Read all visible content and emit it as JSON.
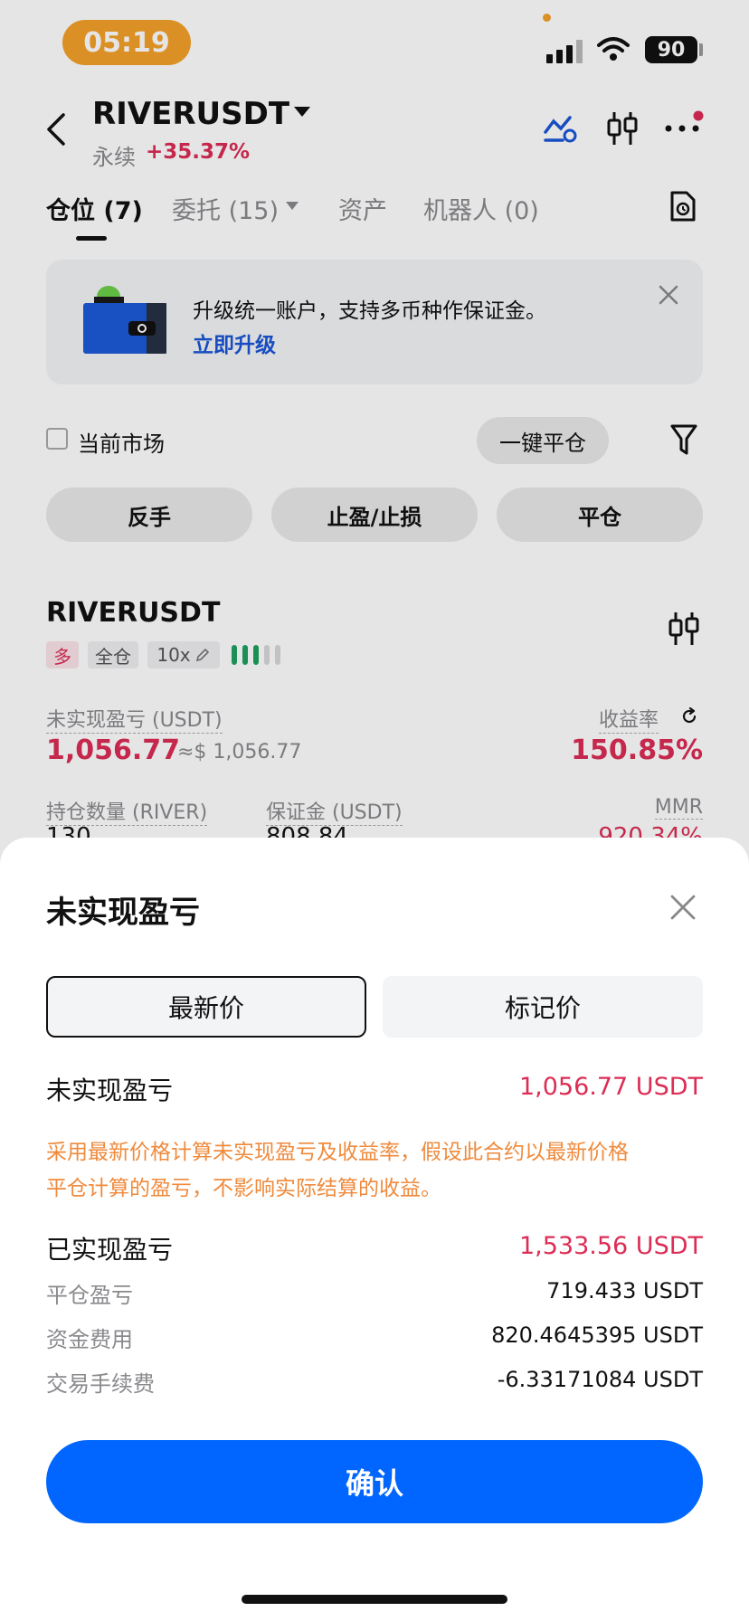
{
  "status_bar": {
    "time": "05:19",
    "battery": "90"
  },
  "header": {
    "symbol": "RIVERUSDT",
    "contract_type": "永续",
    "change": "+35.37%"
  },
  "tabs": [
    {
      "label": "仓位 (7)"
    },
    {
      "label": "委托 (15)"
    },
    {
      "label": "资产"
    },
    {
      "label": "机器人 (0)"
    }
  ],
  "banner": {
    "text": "升级统一账户，支持多币种作保证金。",
    "link": "立即升级"
  },
  "filter": {
    "current_market": "当前市场",
    "close_all": "一键平仓"
  },
  "actions": {
    "reverse": "反手",
    "tp_sl": "止盈/止损",
    "close": "平仓"
  },
  "position": {
    "symbol": "RIVERUSDT",
    "side": "多",
    "margin_mode": "全仓",
    "leverage": "10x",
    "unrealized_label": "未实现盈亏 (USDT)",
    "unrealized_value": "1,056.77",
    "unrealized_usd": "≈$ 1,056.77",
    "roe_label": "收益率",
    "roe_value": "150.85%",
    "qty_label": "持仓数量 (RIVER)",
    "qty_value": "130",
    "margin_label": "保证金 (USDT)",
    "margin_value": "808.84",
    "mmr_label": "MMR",
    "mmr_value": "920.34%"
  },
  "sheet": {
    "title": "未实现盈亏",
    "seg_last": "最新价",
    "seg_mark": "标记价",
    "unrealized_label": "未实现盈亏",
    "unrealized_value": "1,056.77 USDT",
    "note_line1": "采用最新价格计算未实现盈亏及收益率，假设此合约以最新价格",
    "note_line2": "平仓计算的盈亏，不影响实际结算的收益。",
    "realized_label": "已实现盈亏",
    "realized_value": "1,533.56 USDT",
    "rows": [
      {
        "label": "平仓盈亏",
        "value": "719.433 USDT"
      },
      {
        "label": "资金费用",
        "value": "820.4645395 USDT"
      },
      {
        "label": "交易手续费",
        "value": "-6.33171084 USDT"
      }
    ],
    "confirm": "确认"
  },
  "colors": {
    "accent": "#0066ff",
    "loss_profit": "#dc2d55",
    "note": "#ef8a3c",
    "status_pill": "#f4a12a"
  },
  "icons": [
    "back-chevron-icon",
    "dropdown-caret-icon",
    "chart-settings-icon",
    "candlestick-icon",
    "more-icon",
    "history-doc-icon",
    "close-icon",
    "filter-icon",
    "edit-icon",
    "refresh-icon"
  ]
}
